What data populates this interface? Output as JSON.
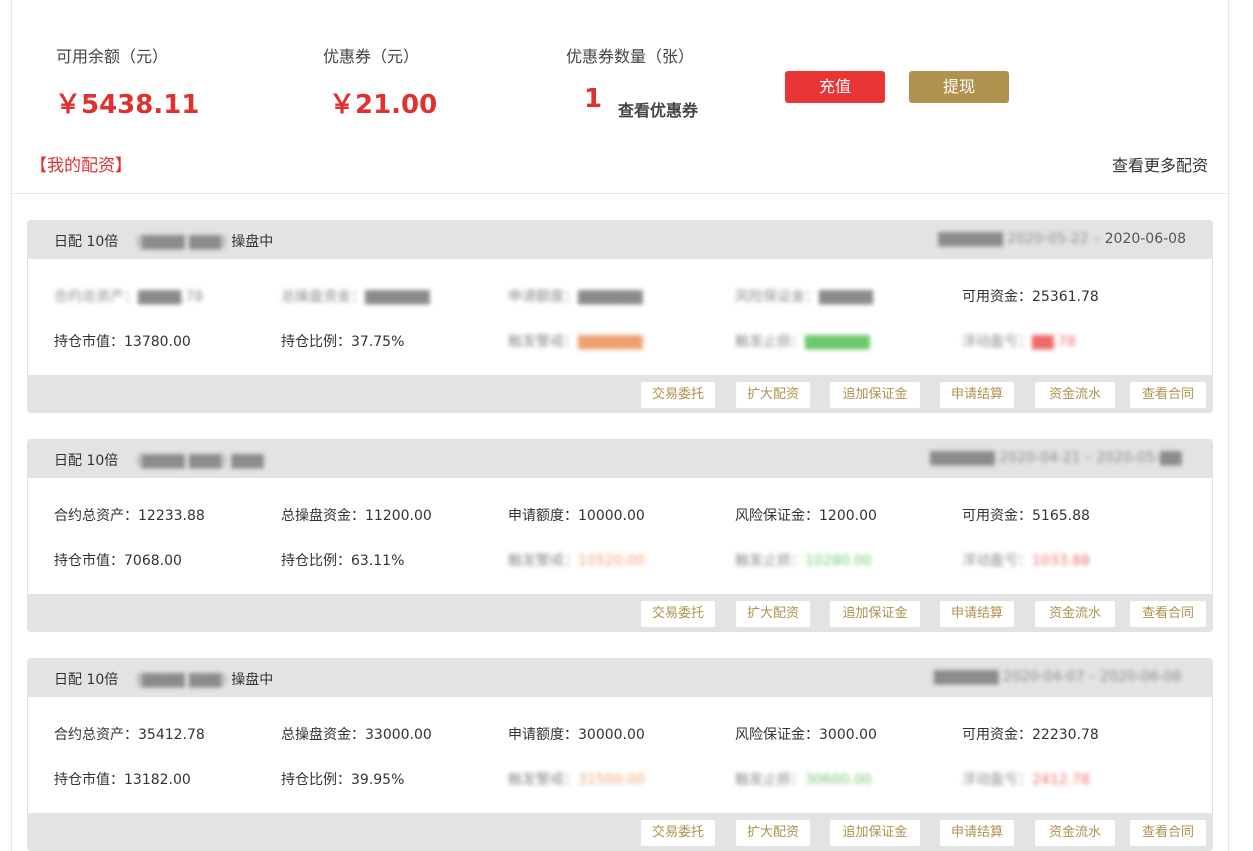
{
  "summary": {
    "balance_label": "可用余额（元）",
    "balance_value": "￥5438.11",
    "coupon_label": "优惠券（元）",
    "coupon_value": "￥21.00",
    "coupon_count_label": "优惠券数量（张）",
    "coupon_count": "1",
    "view_coupons": "查看优惠券",
    "recharge_label": "充值",
    "withdraw_label": "提现"
  },
  "section": {
    "title": "【我的配资】",
    "more_link": "查看更多配资"
  },
  "colors": {
    "accent_red": "#e03131",
    "recharge_bg": "#ea3537",
    "gold": "#b0914e",
    "card_header_bg": "#e3e3e3"
  },
  "cards": [
    {
      "title_prefix": "日配 10倍",
      "title_blur": "(▇▇▇▇  ▇▇▇)",
      "status": "操盘中",
      "date_blur": "▇▇▇▇▇▇  2020-05-22 –",
      "date_end": "2020-06-08",
      "row1": [
        {
          "label": "合约总资产：",
          "value": "▇▇▇▇.78",
          "blur": true
        },
        {
          "label": "总操盘资金：",
          "value": "▇▇▇▇▇▇",
          "blur": true
        },
        {
          "label": "申请额度：",
          "value": "▇▇▇▇▇▇",
          "blur": true
        },
        {
          "label": "风险保证金：",
          "value": "▇▇▇▇▇",
          "blur": true
        },
        {
          "label": "可用资金：",
          "value": "25361.78",
          "blur": false
        }
      ],
      "row2": [
        {
          "label": "持仓市值：",
          "value": "13780.00",
          "blur": false
        },
        {
          "label": "持仓比例：",
          "value": "37.75%",
          "blur": false
        },
        {
          "label": "触发警戒：",
          "value": "▇▇▇▇▇▇",
          "blur": true,
          "tone": "orange"
        },
        {
          "label": "触发止损：",
          "value": "▇▇▇▇▇▇",
          "blur": true,
          "tone": "green"
        },
        {
          "label": "浮动盈亏：",
          "value": "▇▇.78",
          "blur": true,
          "tone": "red"
        }
      ]
    },
    {
      "title_prefix": "日配 10倍",
      "title_blur": "(▇▇▇▇  ▇▇▇)  ▇▇▇",
      "status": "",
      "date_blur": "▇▇▇▇▇▇  2020-04-21 – 2020-05-▇▇",
      "date_end": "",
      "row1": [
        {
          "label": "合约总资产：",
          "value": "12233.88",
          "blur": false
        },
        {
          "label": "总操盘资金：",
          "value": "11200.00",
          "blur": false
        },
        {
          "label": "申请额度：",
          "value": "10000.00",
          "blur": false
        },
        {
          "label": "风险保证金：",
          "value": "1200.00",
          "blur": false
        },
        {
          "label": "可用资金：",
          "value": "5165.88",
          "blur": false
        }
      ],
      "row2": [
        {
          "label": "持仓市值：",
          "value": "7068.00",
          "blur": false
        },
        {
          "label": "持仓比例：",
          "value": "63.11%",
          "blur": false
        },
        {
          "label": "触发警戒：",
          "value": "10520.00",
          "blur": true,
          "tone": "orange"
        },
        {
          "label": "触发止损：",
          "value": "10280.00",
          "blur": true,
          "tone": "green"
        },
        {
          "label": "浮动盈亏：",
          "value": "1033.88",
          "blur": true,
          "tone": "red"
        }
      ]
    },
    {
      "title_prefix": "日配 10倍",
      "title_blur": "(▇▇▇▇  ▇▇▇)",
      "status": "操盘中",
      "date_blur": "▇▇▇▇▇▇  2020-04-07 – 2020-06-08",
      "date_end": "",
      "row1": [
        {
          "label": "合约总资产：",
          "value": "35412.78",
          "blur": false
        },
        {
          "label": "总操盘资金：",
          "value": "33000.00",
          "blur": false
        },
        {
          "label": "申请额度：",
          "value": "30000.00",
          "blur": false
        },
        {
          "label": "风险保证金：",
          "value": "3000.00",
          "blur": false
        },
        {
          "label": "可用资金：",
          "value": "22230.78",
          "blur": false
        }
      ],
      "row2": [
        {
          "label": "持仓市值：",
          "value": "13182.00",
          "blur": false
        },
        {
          "label": "持仓比例：",
          "value": "39.95%",
          "blur": false
        },
        {
          "label": "触发警戒：",
          "value": "31500.00",
          "blur": true,
          "tone": "orange"
        },
        {
          "label": "触发止损：",
          "value": "30600.00",
          "blur": true,
          "tone": "green"
        },
        {
          "label": "浮动盈亏：",
          "value": "2412.78",
          "blur": true,
          "tone": "red"
        }
      ]
    }
  ],
  "actions": [
    "交易委托",
    "扩大配资",
    "追加保证金",
    "申请结算",
    "资金流水",
    "查看合同"
  ]
}
